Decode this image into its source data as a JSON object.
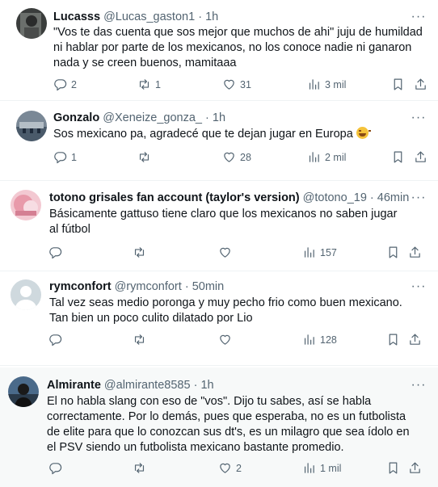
{
  "replies": [
    {
      "name": "Lucasss",
      "handle": "@Lucas_gaston1",
      "time": "1h",
      "text": "\"Vos te das cuenta que sos mejor que muchos de ahi\" juju de humildad ni hablar por parte de los mexicanos, no los conoce nadie ni ganaron nada y se creen buenos, mamitaaa",
      "replies": "2",
      "retweets": "1",
      "likes": "31",
      "views": "3 mil"
    },
    {
      "name": "Gonzalo",
      "handle": "@Xeneize_gonza_",
      "time": "1h",
      "text": "Sos mexicano pa, agradecé que te dejan jugar en Europa",
      "emoji": "laughing-face-emoji",
      "replies": "1",
      "retweets": "",
      "likes": "28",
      "views": "2 mil"
    },
    {
      "name": "totono grisales fan account (taylor's version)",
      "handle": "@totono_19",
      "time": "46min",
      "text": "Básicamente gattuso tiene claro que los mexicanos no saben jugar al fútbol",
      "replies": "",
      "retweets": "",
      "likes": "",
      "views": "157"
    },
    {
      "name": "rymconfort",
      "handle": "@rymconfort",
      "time": "50min",
      "text": "Tal vez seas medio poronga y muy pecho frio como buen mexicano.  Tan bien un poco culito dilatado por Lio",
      "replies": "",
      "retweets": "",
      "likes": "",
      "views": "128"
    },
    {
      "name": "Almirante",
      "handle": "@almirante8585",
      "time": "1h",
      "text": "El no habla slang con eso de \"vos\". Dijo tu sabes, así se habla correctamente. Por lo demás, pues que esperaba, no es un futbolista de elite para que lo conozcan sus dt's, es un milagro que sea ídolo en el PSV siendo un futbolista mexicano bastante promedio.",
      "replies": "",
      "retweets": "",
      "likes": "2",
      "views": "1 mil"
    }
  ],
  "separator": "·",
  "icons": {
    "reply": "reply-icon",
    "retweet": "retweet-icon",
    "like": "heart-icon",
    "views": "views-icon",
    "bookmark": "bookmark-icon",
    "share": "share-icon",
    "more": "more-icon"
  }
}
